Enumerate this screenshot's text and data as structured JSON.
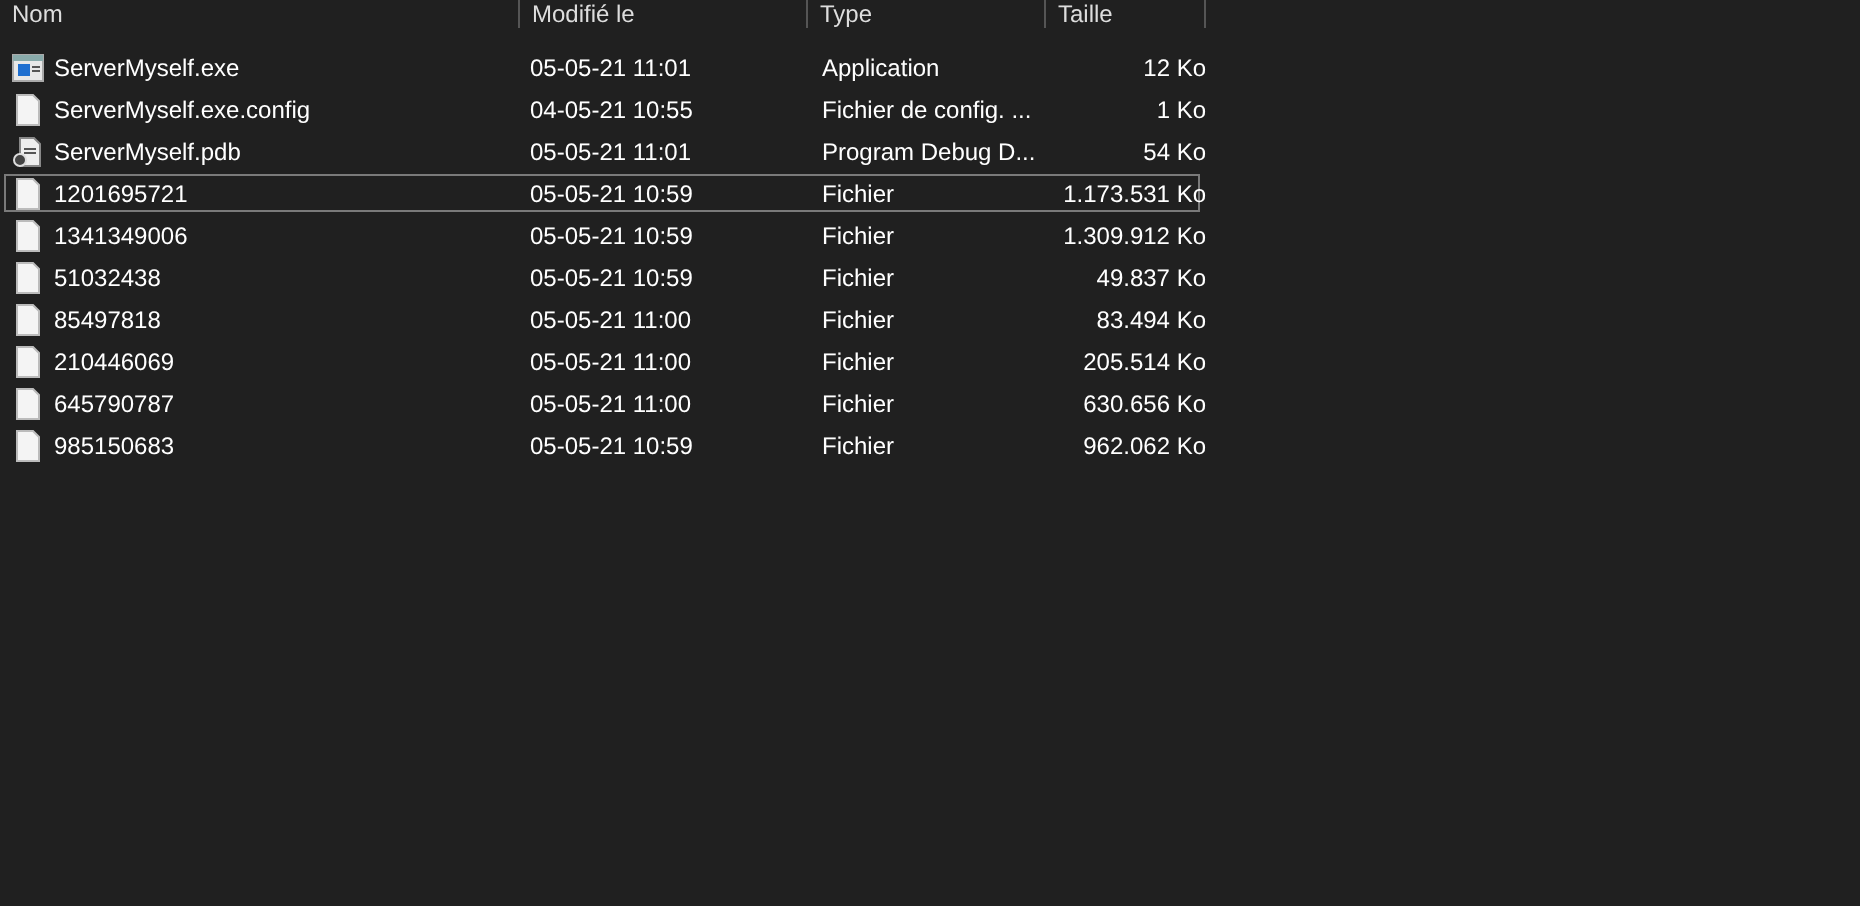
{
  "table": {
    "columns": [
      "Nom",
      "Modifié le",
      "Type",
      "Taille"
    ],
    "rows": [
      {
        "kind": "app",
        "name": "ServerMyself.exe",
        "modified": "05-05-21 11:01",
        "type": "Application",
        "size": "12 Ko",
        "focused": false
      },
      {
        "kind": "file",
        "name": "ServerMyself.exe.config",
        "modified": "04-05-21 10:55",
        "type": "Fichier de config. ...",
        "size": "1 Ko",
        "focused": false
      },
      {
        "kind": "pdb",
        "name": "ServerMyself.pdb",
        "modified": "05-05-21 11:01",
        "type": "Program Debug D...",
        "size": "54 Ko",
        "focused": false
      },
      {
        "kind": "file",
        "name": "1201695721",
        "modified": "05-05-21 10:59",
        "type": "Fichier",
        "size": "1.173.531 Ko",
        "focused": true
      },
      {
        "kind": "file",
        "name": "1341349006",
        "modified": "05-05-21 10:59",
        "type": "Fichier",
        "size": "1.309.912 Ko",
        "focused": false
      },
      {
        "kind": "file",
        "name": "51032438",
        "modified": "05-05-21 10:59",
        "type": "Fichier",
        "size": "49.837 Ko",
        "focused": false
      },
      {
        "kind": "file",
        "name": "85497818",
        "modified": "05-05-21 11:00",
        "type": "Fichier",
        "size": "83.494 Ko",
        "focused": false
      },
      {
        "kind": "file",
        "name": "210446069",
        "modified": "05-05-21 11:00",
        "type": "Fichier",
        "size": "205.514 Ko",
        "focused": false
      },
      {
        "kind": "file",
        "name": "645790787",
        "modified": "05-05-21 11:00",
        "type": "Fichier",
        "size": "630.656 Ko",
        "focused": false
      },
      {
        "kind": "file",
        "name": "985150683",
        "modified": "05-05-21 10:59",
        "type": "Fichier",
        "size": "962.062 Ko",
        "focused": false
      }
    ]
  }
}
